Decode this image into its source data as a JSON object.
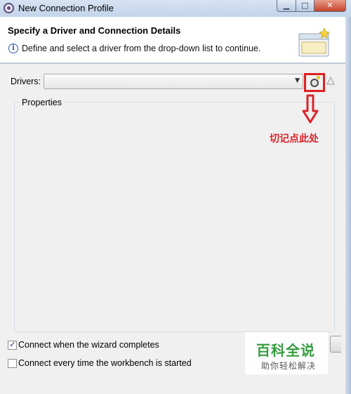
{
  "window": {
    "title": "New Connection Profile",
    "min_glyph": "▁",
    "max_glyph": "□",
    "close_glyph": "✕"
  },
  "header": {
    "title": "Specify a Driver and Connection Details",
    "description": "Define and select a driver from the drop-down list to continue.",
    "info_glyph": "i"
  },
  "drivers": {
    "label": "Drivers:",
    "selected": "",
    "dropdown_glyph": "▼"
  },
  "properties": {
    "label": "Properties"
  },
  "annotation": {
    "text": "切记点此处",
    "color": "#d9242a"
  },
  "options": {
    "connect_on_finish": {
      "label": "Connect when the wizard completes",
      "checked": true
    },
    "connect_on_startup": {
      "label": "Connect every time the workbench is started",
      "checked": false
    }
  },
  "watermark": {
    "title": "百科全说",
    "subtitle": "助你轻松解决"
  },
  "icons": {
    "app": "eclipse-datatools-icon",
    "new_driver": "new-driver-definition-icon",
    "warning": "warning-triangle-icon",
    "info": "info-icon"
  }
}
